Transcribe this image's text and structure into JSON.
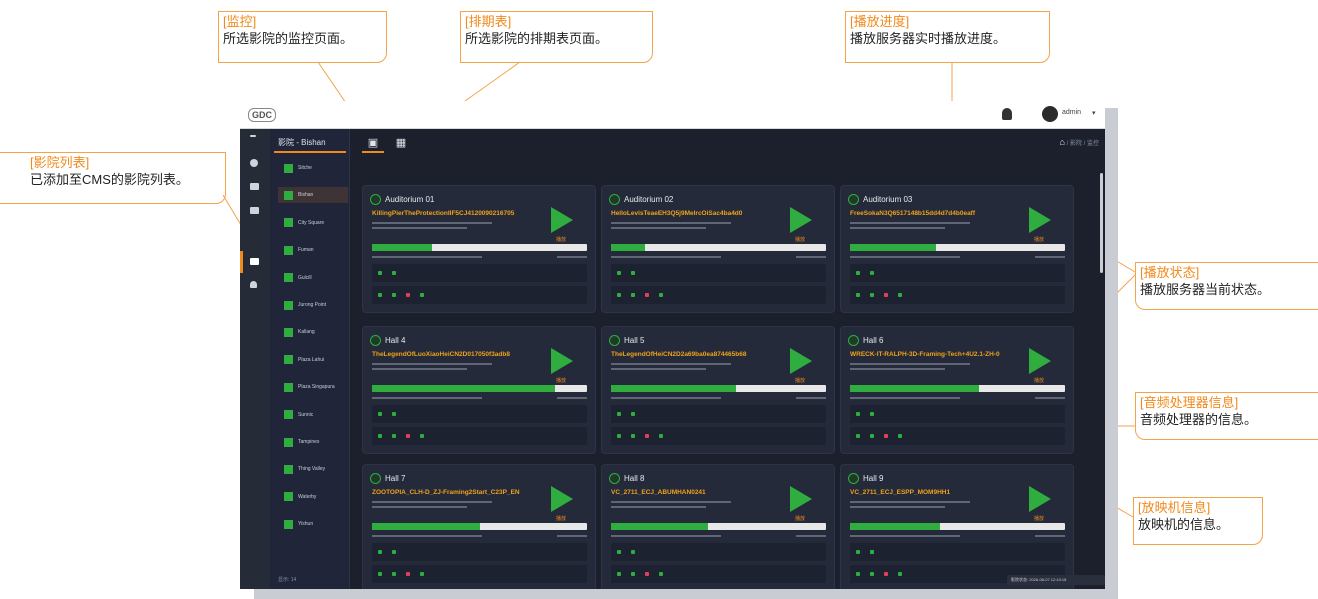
{
  "callouts": {
    "monitor": {
      "title": "[监控]",
      "desc": "所选影院的监控页面。"
    },
    "schedule": {
      "title": "[排期表]",
      "desc": "所选影院的排期表页面。"
    },
    "progress": {
      "title": "[播放进度]",
      "desc": "播放服务器实时播放进度。"
    },
    "cinema_list": {
      "title": "[影院列表]",
      "desc": "已添加至CMS的影院列表。"
    },
    "play_state": {
      "title": "[播放状态]",
      "desc": "播放服务器当前状态。"
    },
    "audio": {
      "title": "[音频处理器信息]",
      "desc": "音频处理器的信息。"
    },
    "projector": {
      "title": "[放映机信息]",
      "desc": "放映机的信息。"
    }
  },
  "app": {
    "logo": "GDC",
    "user": "admin",
    "sidebar_title": "影院 - Bishan",
    "sidebar_items": [
      "Sitche",
      "Bishan",
      "City Square",
      "Fuman",
      "Gulcill",
      "Jurong Point",
      "Kallang",
      "Plaza Lahui",
      "Plaza Singapura",
      "Sunnic",
      "Tampines",
      "Thing Valley",
      "Waterby",
      "Yishun"
    ],
    "sidebar_footer": "显示: 14",
    "breadcrumb": "/ 影院 / 监控",
    "taskbar": "影院状态: 2026-08-07 12:43:18",
    "colors": {
      "accent": "#f08a1c",
      "ok": "#2fae3f",
      "panel": "#242a3a"
    }
  },
  "cards": [
    {
      "name": "Auditorium 01",
      "show": "KillingPierTheProtectionIIF5CJ4120090216705",
      "progress": 0.28,
      "play": "播放"
    },
    {
      "name": "Auditorium 02",
      "show": "HelloLevisTeaeEH3Q5j9MelrcOiSac4ba4d0",
      "progress": 0.16,
      "play": "播放"
    },
    {
      "name": "Auditorium 03",
      "show": "FreeSokaN3Q6517148b15dd4d7d4b0eaff",
      "progress": 0.4,
      "play": "播放"
    },
    {
      "name": "Hall 4",
      "show": "TheLegendOfLuoXiaoHeiCN2D017050f3adb8",
      "progress": 0.85,
      "play": "播放"
    },
    {
      "name": "Hall 5",
      "show": "TheLegendOfHeiCN2D2a69ba0ea874465b68",
      "progress": 0.58,
      "play": "播放"
    },
    {
      "name": "Hall 6",
      "show": "WRECK-IT-RALPH-3D-Framing-Tech+4U2.1-ZH-0",
      "progress": 0.6,
      "play": "播放"
    },
    {
      "name": "Hall 7",
      "show": "ZOOTOPIA_CLH-D_ZJ-Framing2Start_C23P_EN",
      "progress": 0.5,
      "play": "播放"
    },
    {
      "name": "Hall 8",
      "show": "VC_2711_ECJ_ABUMHAN0241",
      "progress": 0.45,
      "play": "播放"
    },
    {
      "name": "Hall 9",
      "show": "VC_2711_ECJ_ESPP_MOM9HH1",
      "progress": 0.42,
      "play": "播放"
    }
  ]
}
